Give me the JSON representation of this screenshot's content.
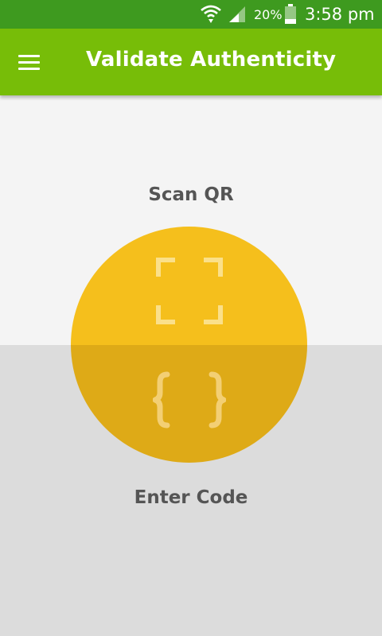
{
  "status_bar": {
    "battery_percent": "20%",
    "time": "3:58 pm"
  },
  "app_bar": {
    "title": "Validate Authenticity"
  },
  "scan": {
    "label": "Scan QR"
  },
  "code": {
    "label": "Enter Code"
  },
  "colors": {
    "status_bar": "#3e9a1f",
    "app_bar": "#77bd08",
    "top_panel": "#f4f4f4",
    "bottom_panel": "#dcdcdc",
    "circle_top": "#f5bf1c",
    "circle_bottom": "#deaa17"
  }
}
